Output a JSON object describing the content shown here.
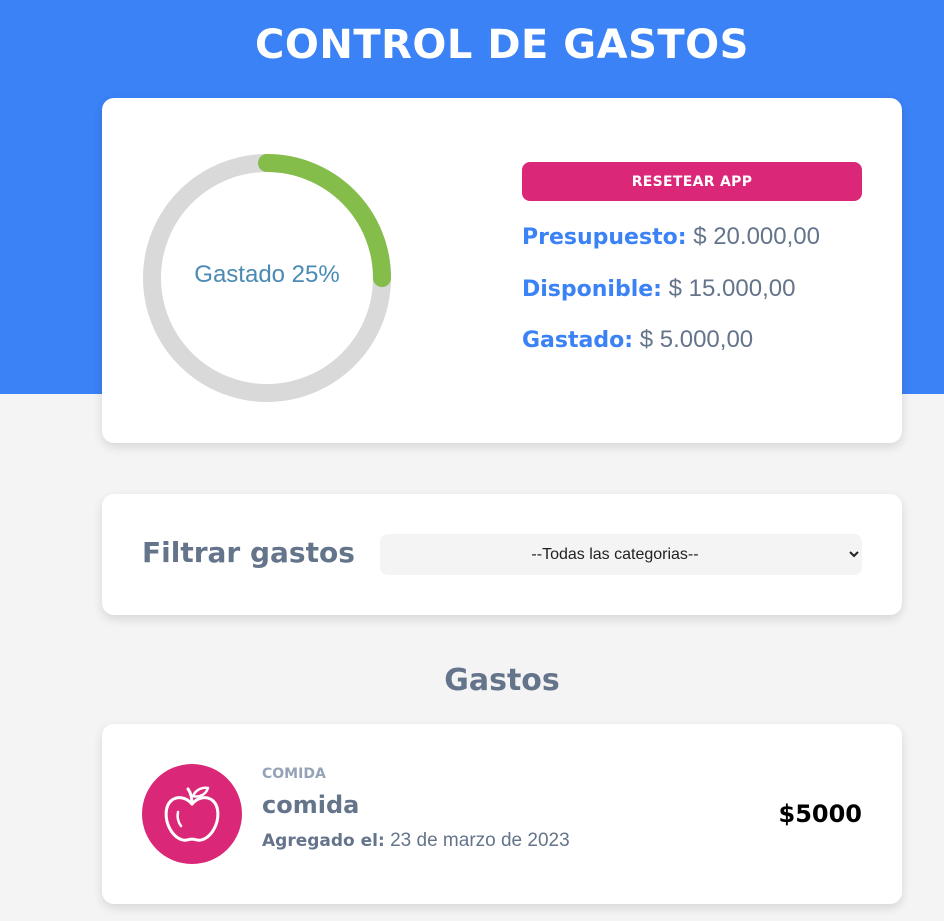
{
  "app": {
    "title": "CONTROL DE GASTOS"
  },
  "budget": {
    "progress_percent": 25,
    "progress_text": "Gastado 25%",
    "reset_label": "Resetear app",
    "presupuesto_label": "Presupuesto:",
    "presupuesto_value": "$ 20.000,00",
    "disponible_label": "Disponible:",
    "disponible_value": "$ 15.000,00",
    "gastado_label": "Gastado:",
    "gastado_value": "$ 5.000,00"
  },
  "filter": {
    "label": "Filtrar gastos",
    "selected_option": "--Todas las categorias--"
  },
  "expenses": {
    "section_title": "Gastos",
    "items": [
      {
        "category": "Comida",
        "name": "comida",
        "date_label": "Agregado el:",
        "date": "23 de marzo de 2023",
        "amount": "$5000",
        "icon": "apple-icon"
      }
    ]
  },
  "colors": {
    "brand_blue": "#3b82f6",
    "accent_pink": "#db2777",
    "progress_green": "#84bd4a",
    "track_gray": "#d9d9d9",
    "text_slate": "#64748b"
  }
}
